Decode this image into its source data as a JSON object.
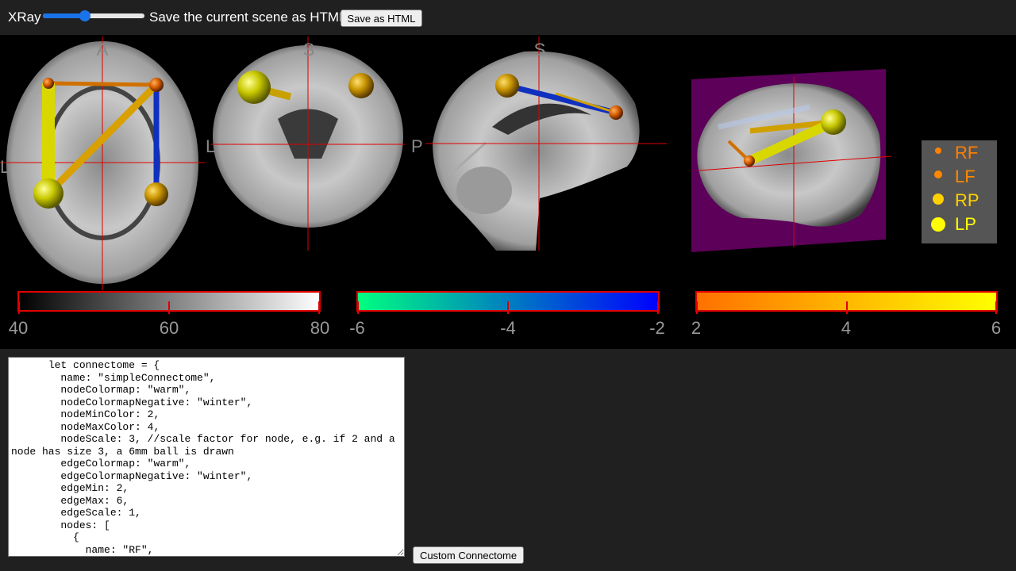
{
  "toolbar": {
    "xray_label": "XRay",
    "xray_value": 40,
    "save_label": "Save the current scene as HTML",
    "save_button": "Save as HTML"
  },
  "views": {
    "axial": {
      "top": "A",
      "left": "L"
    },
    "coronal": {
      "top": "S",
      "left": "L"
    },
    "sagittal": {
      "top": "S",
      "left": "P"
    }
  },
  "legend": [
    {
      "label": "RF",
      "color": "#ff8000"
    },
    {
      "label": "LF",
      "color": "#ff8800"
    },
    {
      "label": "RP",
      "color": "#ffd000"
    },
    {
      "label": "LP",
      "color": "#ffff00"
    }
  ],
  "colorbars": [
    {
      "name": "gray",
      "ticks": [
        "40",
        "60",
        "80"
      ],
      "colors": [
        "#000000",
        "#ffffff"
      ]
    },
    {
      "name": "winter",
      "ticks": [
        "-6",
        "-4",
        "-2"
      ],
      "colors": [
        "#00ff80",
        "#0000ff"
      ]
    },
    {
      "name": "warm",
      "ticks": [
        "2",
        "4",
        "6"
      ],
      "colors": [
        "#ff7000",
        "#ffff00"
      ]
    }
  ],
  "editor": {
    "code": "      let connectome = {\n        name: \"simpleConnectome\",\n        nodeColormap: \"warm\",\n        nodeColormapNegative: \"winter\",\n        nodeMinColor: 2,\n        nodeMaxColor: 4,\n        nodeScale: 3, //scale factor for node, e.g. if 2 and a node has size 3, a 6mm ball is drawn\n        edgeColormap: \"warm\",\n        edgeColormapNegative: \"winter\",\n        edgeMin: 2,\n        edgeMax: 6,\n        edgeScale: 1,\n        nodes: [\n          {\n            name: \"RF\",",
    "button": "Custom Connectome"
  }
}
